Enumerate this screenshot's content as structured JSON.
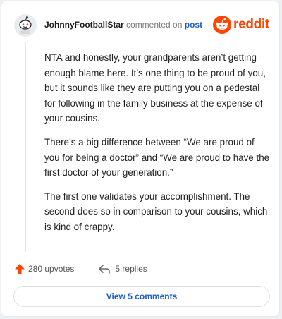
{
  "header": {
    "author": "JohnnyFootballStar",
    "action_text": "commented on",
    "post_link": "post",
    "brand_name": "reddit",
    "brand_color": "#ff4500",
    "avatar_icon": "snoo-avatar-icon",
    "logo_icon": "reddit-logo-icon"
  },
  "comment": {
    "paragraphs": [
      "NTA and honestly, your grandparents aren’t getting enough blame here. It’s one thing to be proud of you, but it sounds like they are putting you on a pedestal for following in the family business at the expense of your cousins.",
      "There’s a big difference between “We are proud of you for being a doctor” and “We are proud to have the first doctor of your generation.”",
      "The first one validates your accomplishment. The second does so in comparison to your cousins, which is kind of crappy."
    ]
  },
  "actions": {
    "upvotes": "280 upvotes",
    "upvote_icon": "upvote-arrow-icon",
    "replies": "5 replies",
    "reply_icon": "reply-arrow-icon",
    "view_comments": "View 5 comments"
  },
  "colors": {
    "link": "#1d5fc9",
    "upvote": "#ff4500"
  }
}
